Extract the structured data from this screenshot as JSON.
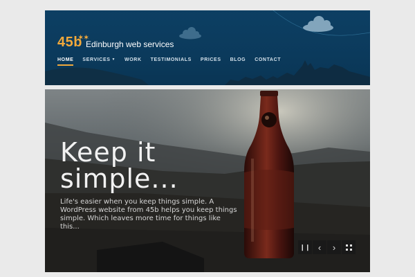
{
  "header": {
    "logo": "45b",
    "logo_stars": "✶✶",
    "tagline": "Edinburgh web services"
  },
  "nav": {
    "items": [
      {
        "label": "HOME"
      },
      {
        "label": "SERVICES",
        "caret": "▼"
      },
      {
        "label": "WORK"
      },
      {
        "label": "TESTIMONIALS"
      },
      {
        "label": "PRICES"
      },
      {
        "label": "BLOG"
      },
      {
        "label": "CONTACT"
      }
    ]
  },
  "hero": {
    "title": "Keep it simple...",
    "text": "Life's easier when you keep things simple. A WordPress website from 45b helps you keep things simple. Which leaves more time for things like this..."
  },
  "slider": {
    "pause_icon": "pause-icon",
    "prev_icon": "chevron-left-icon",
    "next_icon": "chevron-right-icon",
    "fullscreen_icon": "fullscreen-icon"
  },
  "colors": {
    "header_bg": "#0d3f63",
    "accent": "#f2a93b",
    "page_bg": "#eaeaea"
  }
}
